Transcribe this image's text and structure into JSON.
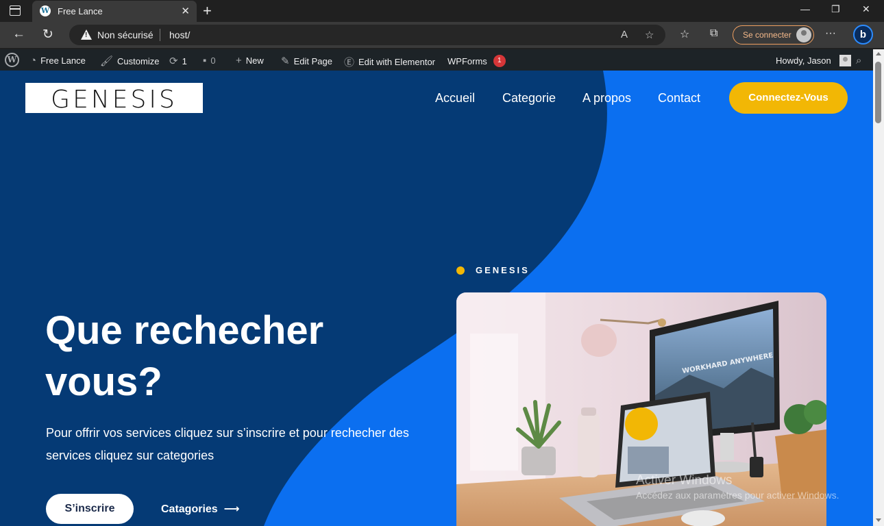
{
  "browser": {
    "tab_title": "Free Lance",
    "tab_favicon": "W",
    "address": {
      "security": "Non sécurisé",
      "url": "host/"
    },
    "signin_label": "Se connecter",
    "bing_label": "b"
  },
  "wp_admin_bar": {
    "site_name": "Free Lance",
    "customize": "Customize",
    "updates_count": "1",
    "comments_count": "0",
    "new": "New",
    "edit_page": "Edit Page",
    "edit_elementor": "Edit with Elementor",
    "wpforms": "WPForms",
    "wpforms_badge": "1",
    "howdy": "Howdy, Jason"
  },
  "site": {
    "logo_text": "GENESIS",
    "menu": [
      "Accueil",
      "Categorie",
      "A propos",
      "Contact"
    ],
    "cta": "Connectez-Vous"
  },
  "hero": {
    "eyebrow": "GENESIS",
    "title": "Que rechecher vous?",
    "subtitle": "Pour offrir vos services cliquez sur s’inscrire et pour rechecher des services cliquez sur categories",
    "primary_button": "S’inscrire",
    "secondary_button": "Catagories",
    "image_screen_text": "WORKHARD ANYWHERE"
  },
  "watermark": {
    "line1": "Activer Windows",
    "line2": "Accédez aux paramètres pour activer Windows."
  },
  "colors": {
    "dark_blue": "#053a75",
    "bright_blue": "#0b6ff0",
    "accent_yellow": "#f2b705",
    "wp_bar": "#1d2327"
  }
}
